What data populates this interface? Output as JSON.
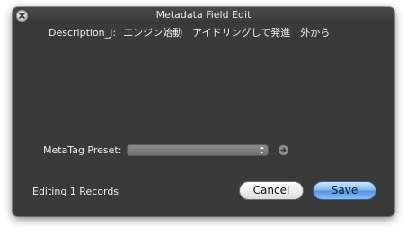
{
  "window": {
    "title": "Metadata Field Edit"
  },
  "description": {
    "label": "Description_J:",
    "value": "エンジン始動　アイドリングして発進　外から"
  },
  "preset": {
    "label": "MetaTag Preset:",
    "selected": ""
  },
  "footer": {
    "status": "Editing 1 Records",
    "cancel_label": "Cancel",
    "save_label": "Save"
  },
  "colors": {
    "window_bg": "#3a3a3a",
    "save_accent": "#5b9be6"
  },
  "icons": {
    "close": "close-icon",
    "select_arrows": "chevron-updown-icon",
    "go": "arrow-right-icon"
  }
}
